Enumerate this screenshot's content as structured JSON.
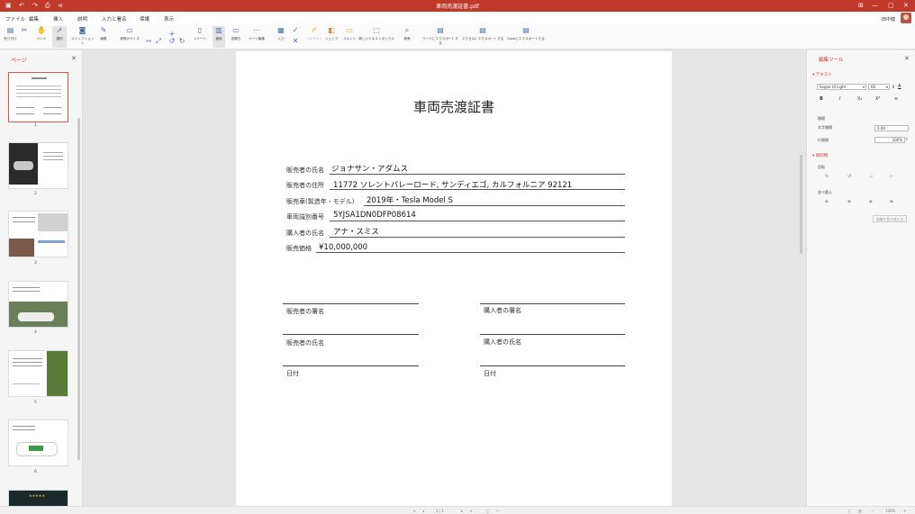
{
  "window": {
    "title": "車両売渡証書.pdf",
    "accent": "#c0392b"
  },
  "menu": {
    "items": [
      "ファイル",
      "編集",
      "挿入",
      "説明",
      "入力と署名",
      "保護",
      "表示"
    ],
    "user": "田中健"
  },
  "toolbar": {
    "tools": [
      {
        "label": "貼り付け",
        "icon": "paste-icon"
      },
      {
        "label": "ハンド",
        "icon": "hand-icon"
      },
      {
        "label": "選択",
        "icon": "select-icon"
      },
      {
        "label": "スナップショット",
        "icon": "camera-icon"
      },
      {
        "label": "編集",
        "icon": "edit-icon"
      },
      {
        "label": "実際のサイズ",
        "icon": "actual-size-icon"
      },
      {
        "label": "1ページ",
        "icon": "single-page-icon"
      },
      {
        "label": "連続",
        "icon": "continuous-icon"
      },
      {
        "label": "見開き",
        "icon": "two-page-icon"
      },
      {
        "label": "ページ編集",
        "icon": "page-edit-icon"
      },
      {
        "label": "入力",
        "icon": "fill-icon"
      },
      {
        "label": "ハイライト",
        "icon": "highlight-icon"
      },
      {
        "label": "シェイプ",
        "icon": "shape-icon"
      },
      {
        "label": "コメント",
        "icon": "comment-icon"
      },
      {
        "label": "新しいテキストボックス",
        "icon": "textbox-icon"
      },
      {
        "label": "検索",
        "icon": "search-icon"
      },
      {
        "label": "ワードにエクスポートする",
        "icon": "export-word-icon"
      },
      {
        "label": "エクセルにエクスポートする",
        "icon": "export-excel-icon"
      },
      {
        "label": "Epubにエクスポートする",
        "icon": "export-epub-icon"
      }
    ],
    "zoom": "130%"
  },
  "left_panel": {
    "title": "ページ",
    "thumbnails": [
      "1",
      "2",
      "3",
      "4",
      "5",
      "6"
    ]
  },
  "document": {
    "title": "車両売渡証書",
    "fields": [
      {
        "label": "販売者の氏名",
        "value": "ジョナサン・アダムス"
      },
      {
        "label": "販売者の住所",
        "value": "11772 ソレントバレーロード, サンディエゴ, カルフォルニア 92121"
      },
      {
        "label": "販売車(製造年・モデル)",
        "value": "2019年・Tesla Model S"
      },
      {
        "label": "車両識別番号",
        "value": "5YJSA1DN0DFP08614"
      },
      {
        "label": "購入者の氏名",
        "value": "アナ・スミス"
      },
      {
        "label": "販売価格",
        "value": "¥10,000,000"
      }
    ],
    "signatures": {
      "seller_sign": "販売者の署名",
      "buyer_sign": "購入者の署名",
      "seller_name": "販売者の氏名",
      "buyer_name": "購入者の氏名",
      "date_left": "日付",
      "date_right": "日付"
    }
  },
  "right_panel": {
    "title": "編集ツール",
    "text_section": "テキスト",
    "font": "Segoe UI Light",
    "size": "60",
    "spacing_header": "間隔",
    "char_spacing_label": "文字間隔",
    "char_spacing": "0.00",
    "line_spacing_label": "行間隔",
    "line_spacing": "100%",
    "object_section": "目的物",
    "rotate_label": "回転",
    "arrange_label": "並べ替え",
    "replace_button": "画像を置き換える"
  },
  "status": {
    "page_indicator": "1 / 1",
    "zoom": "130%"
  }
}
